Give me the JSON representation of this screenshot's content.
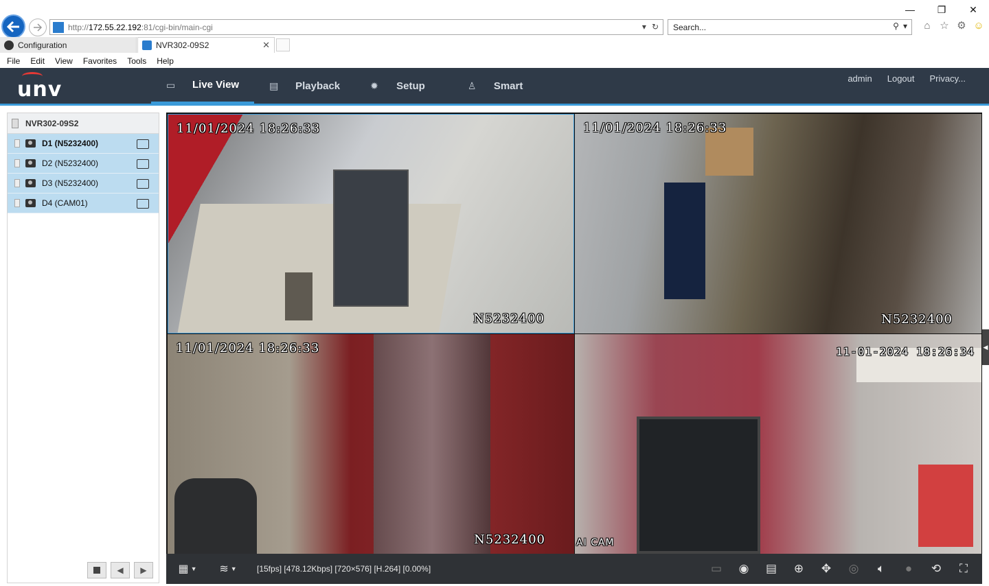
{
  "browser": {
    "url_prefix": "http://",
    "url_host": "172.55.22.192",
    "url_port": ":81",
    "url_path": "/cgi-bin/main-cgi",
    "search_placeholder": "Search...",
    "tabs": [
      {
        "label": "Configuration",
        "active": false
      },
      {
        "label": "NVR302-09S2",
        "active": true
      }
    ],
    "menu": [
      "File",
      "Edit",
      "View",
      "Favorites",
      "Tools",
      "Help"
    ]
  },
  "app": {
    "logo_text": "unv",
    "nav": [
      {
        "label": "Live View",
        "icon": "monitor-icon",
        "active": true
      },
      {
        "label": "Playback",
        "icon": "film-icon",
        "active": false
      },
      {
        "label": "Setup",
        "icon": "gear-icon",
        "active": false
      },
      {
        "label": "Smart",
        "icon": "person-icon",
        "active": false
      }
    ],
    "user": {
      "name": "admin",
      "logout": "Logout",
      "privacy": "Privacy..."
    }
  },
  "devices": {
    "root": "NVR302-09S2",
    "channels": [
      {
        "label": "D1 (N5232400)",
        "selected": true
      },
      {
        "label": "D2 (N5232400)",
        "selected": false
      },
      {
        "label": "D3 (N5232400)",
        "selected": false
      },
      {
        "label": "D4 (CAM01)",
        "selected": false
      }
    ]
  },
  "tiles": [
    {
      "timestamp": "11/01/2024 18:26:33",
      "name": "N5232400"
    },
    {
      "timestamp": "11/01/2024 18:26:33",
      "name": "N5232400"
    },
    {
      "timestamp": "11/01/2024 18:26:33",
      "name": "N5232400"
    },
    {
      "timestamp": "11-01-2024 18:26:34",
      "name": "AI CAM"
    }
  ],
  "toolbar": {
    "status": "[15fps] [478.12Kbps] [720×576] [H.264] [0.00%]"
  }
}
